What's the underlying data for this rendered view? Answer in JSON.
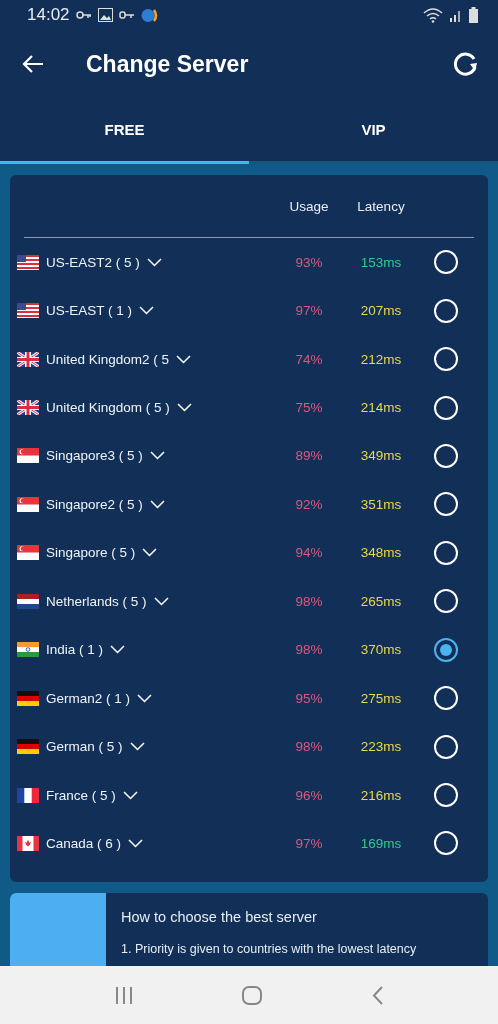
{
  "status_bar": {
    "time": "14:02"
  },
  "app_bar": {
    "title": "Change Server"
  },
  "tabs": [
    {
      "label": "FREE",
      "selected": true
    },
    {
      "label": "VIP",
      "selected": false
    }
  ],
  "columns": [
    "Usage",
    "Latency"
  ],
  "servers": [
    {
      "kind": "us",
      "name": "US-EAST2 ( 5 )",
      "usage": "93%",
      "latency": "153ms",
      "color": "#2ecc8a",
      "selected": false
    },
    {
      "kind": "us",
      "name": "US-EAST ( 1 )",
      "usage": "97%",
      "latency": "207ms",
      "color": "#e8d84a",
      "selected": false
    },
    {
      "kind": "uk",
      "name": "United Kingdom2 ( 5",
      "usage": "74%",
      "latency": "212ms",
      "color": "#e8d84a",
      "selected": false
    },
    {
      "kind": "uk",
      "name": "United Kingdom ( 5 )",
      "usage": "75%",
      "latency": "214ms",
      "color": "#e8d84a",
      "selected": false
    },
    {
      "kind": "sg",
      "name": "Singapore3 ( 5 )",
      "usage": "89%",
      "latency": "349ms",
      "color": "#e8d84a",
      "selected": false
    },
    {
      "kind": "sg",
      "name": "Singapore2 ( 5 )",
      "usage": "92%",
      "latency": "351ms",
      "color": "#e8d84a",
      "selected": false
    },
    {
      "kind": "sg",
      "name": "Singapore ( 5 )",
      "usage": "94%",
      "latency": "348ms",
      "color": "#e8d84a",
      "selected": false
    },
    {
      "kind": "nl",
      "name": "Netherlands ( 5 )",
      "usage": "98%",
      "latency": "265ms",
      "color": "#e8d84a",
      "selected": false
    },
    {
      "kind": "in",
      "name": "India ( 1 )",
      "usage": "98%",
      "latency": "370ms",
      "color": "#e8d84a",
      "selected": true
    },
    {
      "kind": "de",
      "name": "German2 ( 1 )",
      "usage": "95%",
      "latency": "275ms",
      "color": "#e8d84a",
      "selected": false
    },
    {
      "kind": "de",
      "name": "German ( 5 )",
      "usage": "98%",
      "latency": "223ms",
      "color": "#e8d84a",
      "selected": false
    },
    {
      "kind": "fr",
      "name": "France ( 5 )",
      "usage": "96%",
      "latency": "216ms",
      "color": "#e8d84a",
      "selected": false
    },
    {
      "kind": "ca",
      "name": "Canada ( 6 )",
      "usage": "97%",
      "latency": "169ms",
      "color": "#2ecc8a",
      "selected": false
    }
  ],
  "tips": {
    "title": "How to choose the best server",
    "lines": [
      "1. Priority is given to countries with the lowest latency"
    ]
  }
}
